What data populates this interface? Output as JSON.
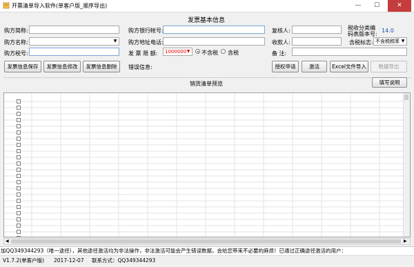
{
  "window": {
    "title": "开票清单导入软件(单客户版_顺序导出)",
    "minimize": "—",
    "maximize": "☐",
    "close": "✕"
  },
  "section_title": "发票基本信息",
  "buyer": {
    "name_label": "购方简称:",
    "name_value": "",
    "fullname_label": "购方名称:",
    "fullname_value": "",
    "tax_label": "购方税号:",
    "tax_value": ""
  },
  "bank": {
    "account_label": "购方银行帐号:",
    "account_value": "",
    "address_label": "购方地址电话:",
    "address_value": ""
  },
  "limit": {
    "label": "发 票 限 额:",
    "value": "1000000",
    "no_tax_label": "不含税",
    "with_tax_label": "含税",
    "selected": "不含税"
  },
  "error_label": "错误信息:",
  "people": {
    "reviewer_label": "复核人:",
    "reviewer_value": "",
    "payee_label": "收款人:",
    "payee_value": "",
    "note_label": "备 注:",
    "note_value": ""
  },
  "tax_code": {
    "label": "税收分类编码表版本号:",
    "value": "14.0",
    "flag_label": "含税标志:",
    "flag_value": "不含税税率"
  },
  "buttons": {
    "save": "发票信息保存",
    "modify": "发票信息修改",
    "delete": "发票信息删除",
    "authorize": "授权申请",
    "activate": "激活",
    "excel_import": "Excel文件导入",
    "data_export": "数据导出",
    "fill_guide": "填写说明"
  },
  "grid": {
    "header": "销货清单预览",
    "row_count": 23
  },
  "status_text": "加QQ349344293（唯一途径），其他途径激活均为非法操作，非法激活可能会产生错误数据，会给您带来不必要的麻烦！已通过正确途径激活的用户：",
  "footer": {
    "version": "V1.7.2(单客户版)",
    "date": "2017-12-07",
    "contact": "联系方式：QQ349344293"
  }
}
